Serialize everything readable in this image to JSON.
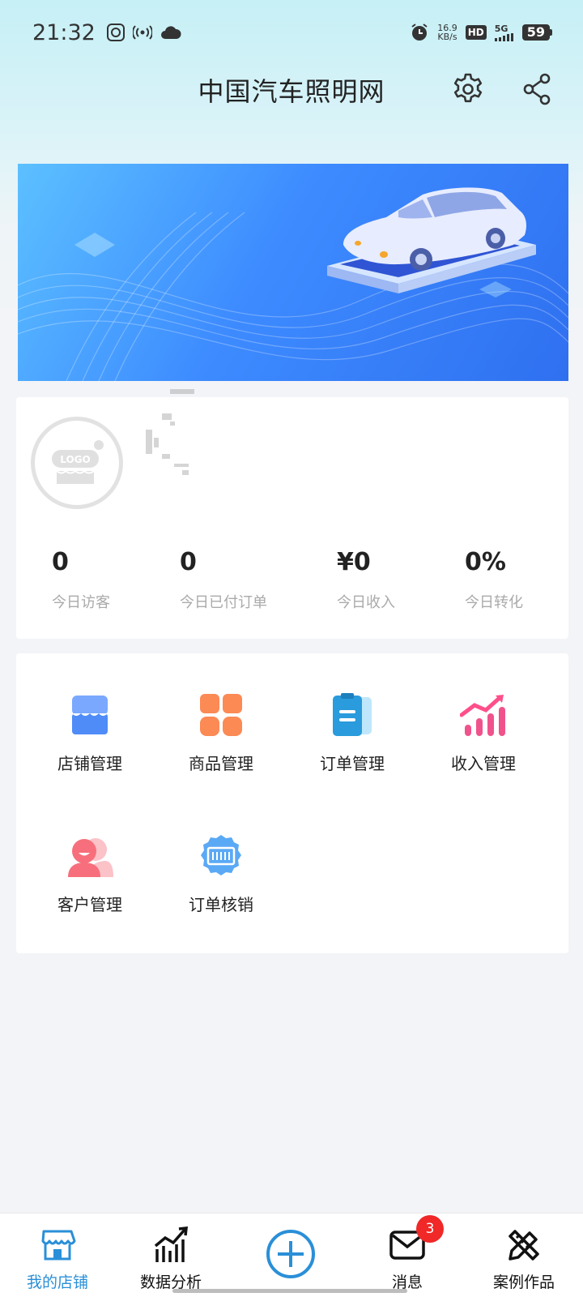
{
  "status_bar": {
    "time": "21:32",
    "net_speed_value": "16.9",
    "net_speed_unit": "KB/s",
    "hd_label": "HD",
    "network_label": "5G",
    "battery_level": "59"
  },
  "header": {
    "title": "中国汽车照明网",
    "settings_icon": "gear-icon",
    "share_icon": "share-icon"
  },
  "store": {
    "logo_text": "LOGO"
  },
  "stats": [
    {
      "value": "0",
      "label": "今日访客"
    },
    {
      "value": "0",
      "label": "今日已付订单"
    },
    {
      "value": "¥0",
      "label": "今日收入"
    },
    {
      "value": "0%",
      "label": "今日转化"
    }
  ],
  "functions": [
    {
      "label": "店铺管理",
      "icon": "store-icon"
    },
    {
      "label": "商品管理",
      "icon": "grid-icon"
    },
    {
      "label": "订单管理",
      "icon": "order-icon"
    },
    {
      "label": "收入管理",
      "icon": "income-icon"
    },
    {
      "label": "客户管理",
      "icon": "customer-icon"
    },
    {
      "label": "订单核销",
      "icon": "verify-icon"
    }
  ],
  "bottom_nav": {
    "items": [
      {
        "label": "我的店铺",
        "icon": "store-icon",
        "active": true
      },
      {
        "label": "数据分析",
        "icon": "chart-icon",
        "active": false
      },
      {
        "label": "",
        "icon": "plus-circle-icon",
        "active": false
      },
      {
        "label": "消息",
        "icon": "mail-icon",
        "active": false
      },
      {
        "label": "案例作品",
        "icon": "pencil-ruler-icon",
        "active": false
      }
    ],
    "message_badge": "3"
  },
  "colors": {
    "accent": "#2a8fd8",
    "badge": "#f02828"
  }
}
